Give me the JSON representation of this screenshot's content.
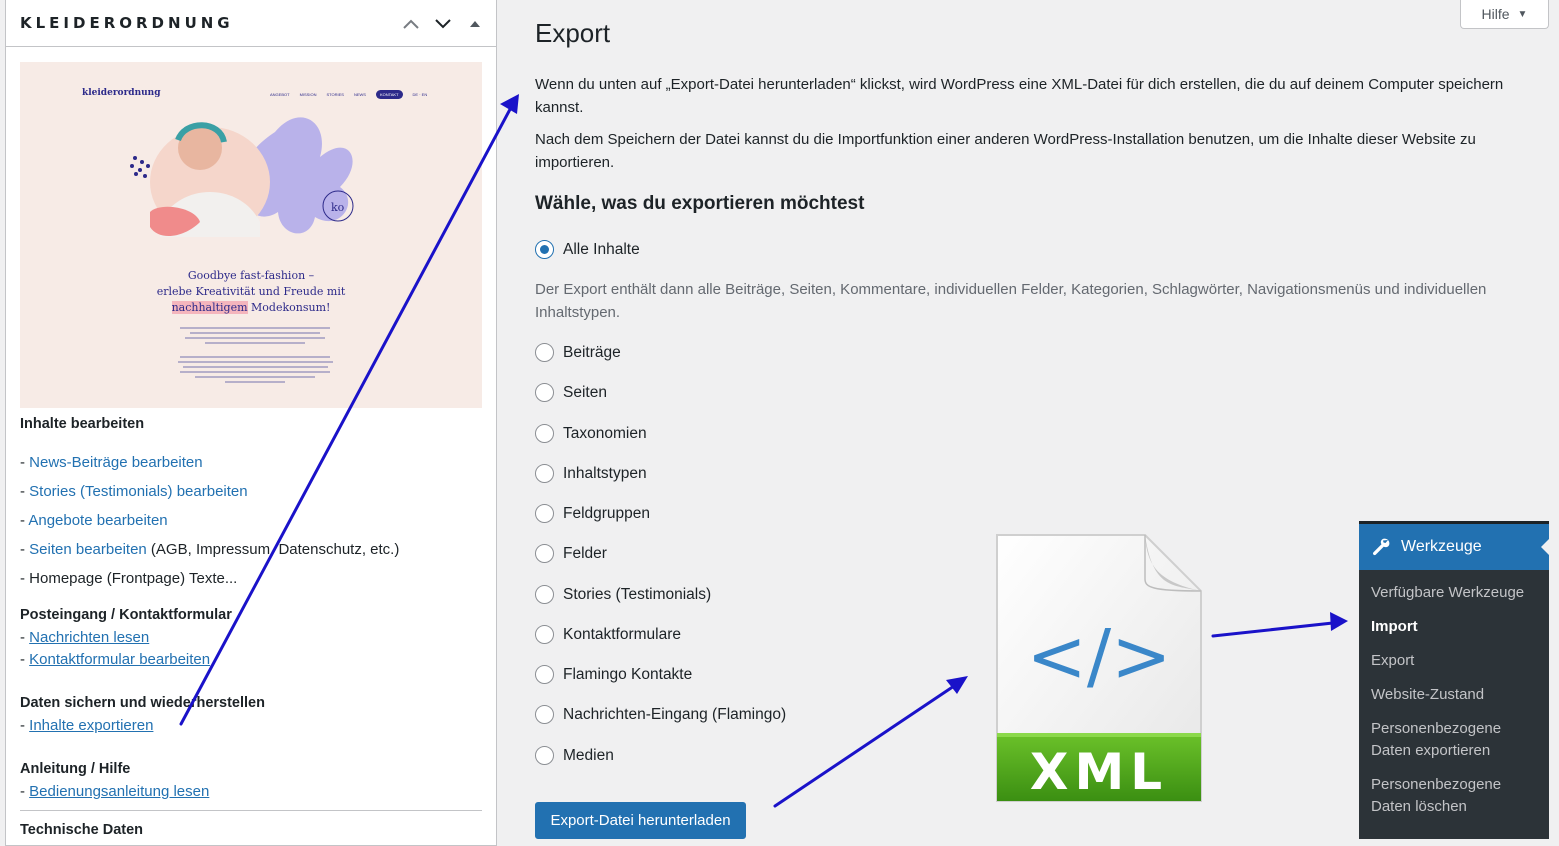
{
  "widget": {
    "title": "KLEIDERORDNUNG",
    "preview": {
      "logo": "kleiderordnung",
      "nav": [
        "ANGEBOT",
        "MISSION",
        "STORIES",
        "NEWS",
        "KONTAKT",
        "DE · EN"
      ],
      "headline_1": "Goodbye fast-fashion –",
      "headline_2": "erlebe Kreativität und Freude mit",
      "headline_3a": "nachhaltigem",
      "headline_3b": " Modekonsum!"
    },
    "section_content": "Inhalte bearbeiten",
    "links_content": [
      {
        "prefix": "- ",
        "link": "News-Beiträge bearbeiten",
        "suffix": ""
      },
      {
        "prefix": "- ",
        "link": "Stories (Testimonials) bearbeiten",
        "suffix": ""
      },
      {
        "prefix": "- ",
        "link": "Angebote bearbeiten",
        "suffix": ""
      },
      {
        "prefix": "- ",
        "link": "Seiten bearbeiten",
        "suffix": " (AGB, Impressum, Datenschutz, etc.)"
      }
    ],
    "homepage_text": "- Homepage (Frontpage) Texte...",
    "section_inbox": "Posteingang / Kontaktformular",
    "inbox_links": [
      "Nachrichten lesen",
      "Kontaktformular bearbeiten"
    ],
    "section_backup": "Daten sichern und wiederherstellen",
    "backup_link": "Inhalte exportieren",
    "section_help": "Anleitung / Hilfe",
    "help_link": "Bedienungsanleitung lesen",
    "section_tech": "Technische Daten",
    "dash": "- "
  },
  "help_tab": {
    "label": "Hilfe",
    "arrow": "▼"
  },
  "main": {
    "title": "Export",
    "para1": "Wenn du unten auf „Export-Datei herunterladen“ klickst, wird WordPress eine XML-Datei für dich erstellen, die du auf deinem Computer speichern kannst.",
    "para2": "Nach dem Speichern der Datei kannst du die Importfunktion einer anderen WordPress-Installation benutzen, um die Inhalte dieser Website zu importieren.",
    "heading": "Wähle, was du exportieren möchtest",
    "all_label": "Alle Inhalte",
    "all_desc": "Der Export enthält dann alle Beiträge, Seiten, Kommentare, individuellen Felder, Kategorien, Schlagwörter, Navigationsmenüs und individuellen Inhaltstypen.",
    "options": [
      "Beiträge",
      "Seiten",
      "Taxonomien",
      "Inhaltstypen",
      "Feldgruppen",
      "Felder",
      "Stories (Testimonials)",
      "Kontaktformulare",
      "Flamingo Kontakte",
      "Nachrichten-Eingang (Flamingo)",
      "Medien"
    ],
    "download_button": "Export-Datei herunterladen"
  },
  "xml_icon": {
    "code": "</>",
    "label": "XML",
    "accent": "#3a87c9",
    "band": "#4aa31a"
  },
  "menu": {
    "header": "Werkzeuge",
    "items": [
      "Verfügbare Werkzeuge",
      "Import",
      "Export",
      "Website-Zustand",
      "Personenbezogene Daten exportieren",
      "Personenbezogene Daten löschen"
    ],
    "active": "Import"
  },
  "colors": {
    "link": "#2271b1",
    "annotation_arrow": "#1a12c9"
  }
}
